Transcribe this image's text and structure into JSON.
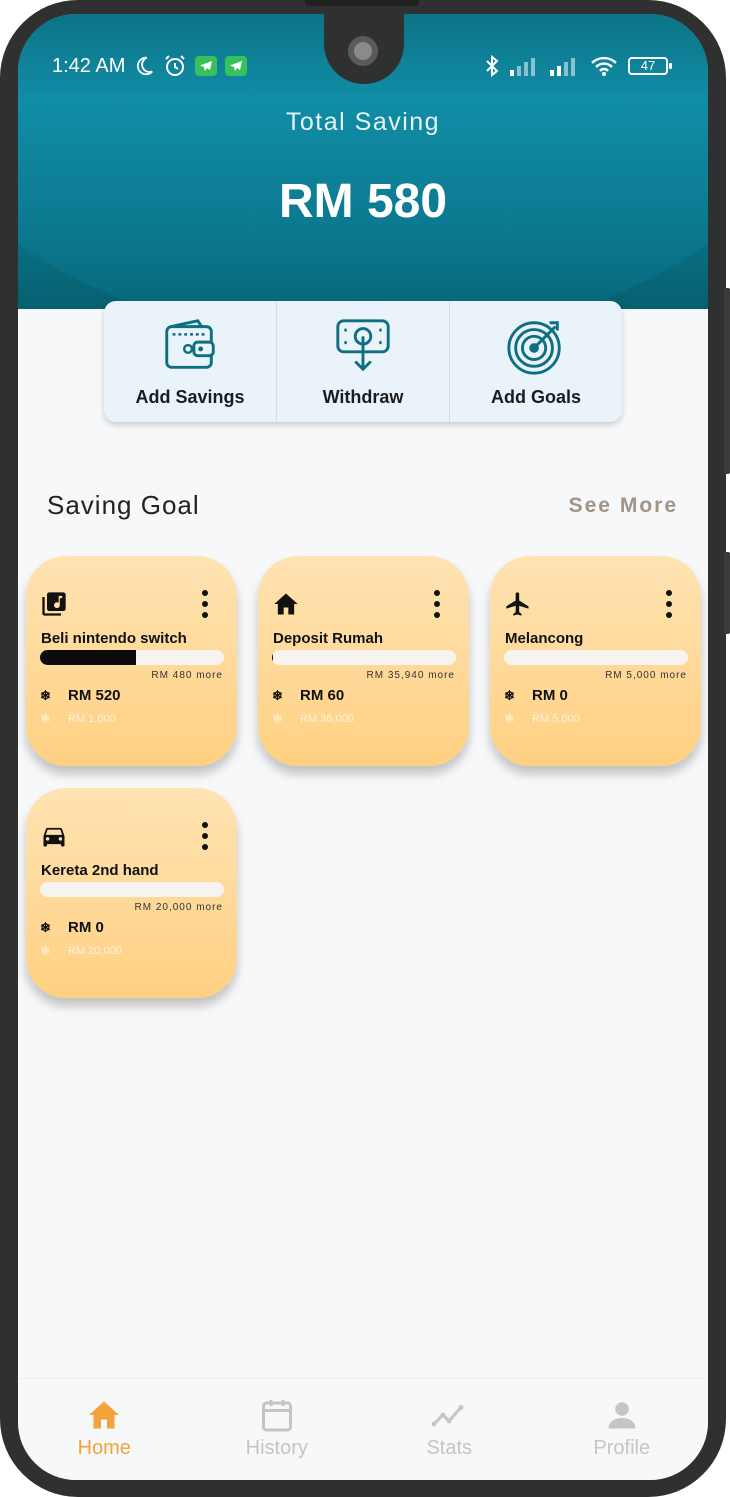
{
  "status_bar": {
    "time": "1:42 AM",
    "battery": "47"
  },
  "header": {
    "total_label": "Total Saving",
    "total_value": "RM 580"
  },
  "actions": [
    {
      "label": "Add Savings",
      "icon": "wallet-icon"
    },
    {
      "label": "Withdraw",
      "icon": "withdraw-icon"
    },
    {
      "label": "Add Goals",
      "icon": "target-icon"
    }
  ],
  "saving_goal": {
    "title": "Saving Goal",
    "see_more": "See More",
    "goals": [
      {
        "icon": "music-library-icon",
        "name": "Beli nintendo switch",
        "progress": 0.52,
        "more": "RM 480 more",
        "saved": "RM 520",
        "target": "RM 1,000"
      },
      {
        "icon": "home-icon",
        "name": "Deposit Rumah",
        "progress": 0.0017,
        "more": "RM 35,940 more",
        "saved": "RM 60",
        "target": "RM 36,000"
      },
      {
        "icon": "airplane-icon",
        "name": "Melancong",
        "progress": 0,
        "more": "RM 5,000 more",
        "saved": "RM 0",
        "target": "RM 5,000"
      },
      {
        "icon": "car-icon",
        "name": "Kereta 2nd hand",
        "progress": 0,
        "more": "RM 20,000 more",
        "saved": "RM 0",
        "target": "RM 20,000"
      }
    ]
  },
  "bottom_nav": [
    {
      "label": "Home",
      "active": true
    },
    {
      "label": "History",
      "active": false
    },
    {
      "label": "Stats",
      "active": false
    },
    {
      "label": "Profile",
      "active": false
    }
  ],
  "colors": {
    "header": "#0c7b92",
    "card": "#ffd896",
    "accent": "#f2a33a",
    "icon_teal": "#0e6f80"
  }
}
